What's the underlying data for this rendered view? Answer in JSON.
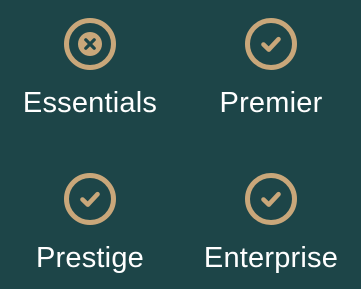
{
  "colors": {
    "background": "#1d4548",
    "icon_gold": "#c9a77a",
    "label_text": "#ffffff"
  },
  "tiers": [
    {
      "label": "Essentials",
      "icon": "x-circle-icon",
      "included": false
    },
    {
      "label": "Premier",
      "icon": "check-circle-icon",
      "included": true
    },
    {
      "label": "Prestige",
      "icon": "check-circle-icon",
      "included": true
    },
    {
      "label": "Enterprise",
      "icon": "check-circle-icon",
      "included": true
    }
  ]
}
